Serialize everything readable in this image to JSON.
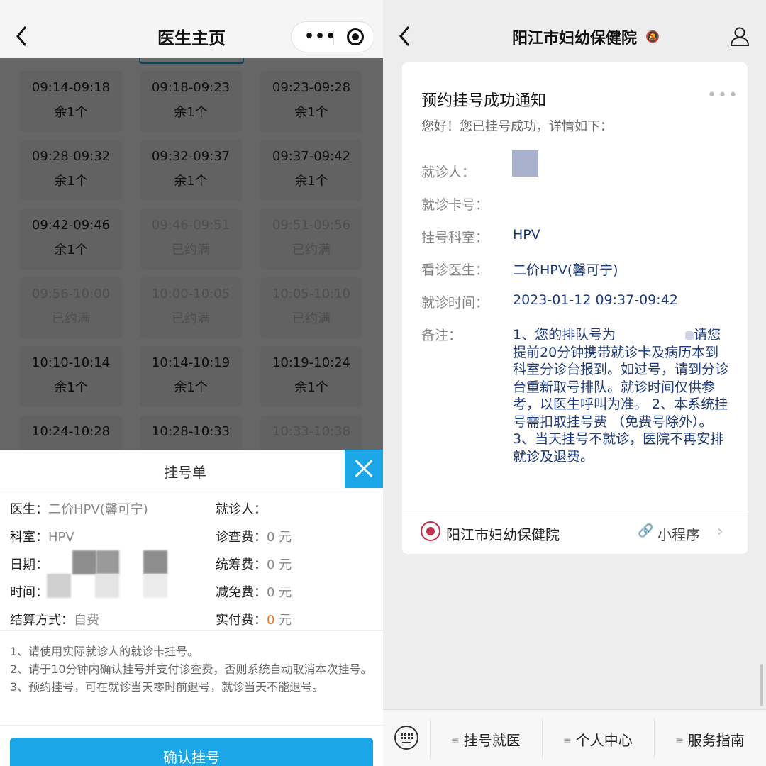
{
  "left": {
    "nav": {
      "title": "医生主页"
    },
    "slots": [
      {
        "time": "09:14-09:18",
        "status": "余1个",
        "full": false
      },
      {
        "time": "09:18-09:23",
        "status": "余1个",
        "full": false
      },
      {
        "time": "09:23-09:28",
        "status": "余1个",
        "full": false
      },
      {
        "time": "09:28-09:32",
        "status": "余1个",
        "full": false
      },
      {
        "time": "09:32-09:37",
        "status": "余1个",
        "full": false
      },
      {
        "time": "09:37-09:42",
        "status": "余1个",
        "full": false
      },
      {
        "time": "09:42-09:46",
        "status": "余1个",
        "full": false
      },
      {
        "time": "09:46-09:51",
        "status": "已约满",
        "full": true
      },
      {
        "time": "09:51-09:56",
        "status": "已约满",
        "full": true
      },
      {
        "time": "09:56-10:00",
        "status": "已约满",
        "full": true
      },
      {
        "time": "10:00-10:05",
        "status": "已约满",
        "full": true
      },
      {
        "time": "10:05-10:10",
        "status": "已约满",
        "full": true
      },
      {
        "time": "10:10-10:14",
        "status": "余1个",
        "full": false
      },
      {
        "time": "10:14-10:19",
        "status": "余1个",
        "full": false
      },
      {
        "time": "10:19-10:24",
        "status": "余1个",
        "full": false
      },
      {
        "time": "10:24-10:28",
        "status": "",
        "full": false
      },
      {
        "time": "10:28-10:33",
        "status": "",
        "full": false
      },
      {
        "time": "10:33-10:38",
        "status": "",
        "full": true
      }
    ],
    "sheet": {
      "title": "挂号单",
      "doctor_label": "医生：",
      "doctor_value": "二价HPV(馨可宁)",
      "dept_label": "科室：",
      "dept_value": "HPV",
      "date_label": "日期：",
      "time_label": "时间：",
      "pay_method_label": "结算方式：",
      "pay_method_value": "自费",
      "patient_label": "就诊人：",
      "consult_fee_label": "诊查费：",
      "consult_fee_value": "0 元",
      "pooled_fee_label": "统筹费：",
      "pooled_fee_value": "0 元",
      "discount_fee_label": "减免费：",
      "discount_fee_value": "0 元",
      "actual_fee_label": "实付费：",
      "actual_fee_amount": "0",
      "actual_fee_unit": " 元",
      "notes": [
        "1、请使用实际就诊人的就诊卡挂号。",
        "2、请于10分钟内确认挂号并支付诊查费，否则系统自动取消本次挂号。",
        "3、预约挂号，可在就诊当天零时前退号，就诊当天不能退号。"
      ],
      "confirm_label": "确认挂号"
    }
  },
  "right": {
    "nav": {
      "title": "阳江市妇幼保健院"
    },
    "card": {
      "title": "预约挂号成功通知",
      "menu": "•••",
      "greeting": "您好！您已挂号成功，详情如下：",
      "patient_label": "就诊人：",
      "card_no_label": "就诊卡号：",
      "dept_label": "挂号科室：",
      "dept_value": "HPV",
      "doctor_label": "看诊医生：",
      "doctor_value": "二价HPV(馨可宁)",
      "time_label": "就诊时间：",
      "time_value": "2023-01-12 09:37-09:42",
      "remark_label": "备注：",
      "remark_part1": "1、您的排队号为",
      "remark_part2": "请您提前20分钟携带就诊卡及病历本到科室分诊台报到。如过号，请到分诊台重新取号排队。就诊时间仅供参考，以医生呼叫为准。 2、本系统挂号需扣取挂号费 （免费号除外）。 3、当天挂号不就诊，医院不再安排就诊及退费。",
      "hospital_name": "阳江市妇幼保健院",
      "mini_program": "小程序"
    },
    "bottom_menu": [
      "挂号就医",
      "个人中心",
      "服务指南"
    ]
  }
}
